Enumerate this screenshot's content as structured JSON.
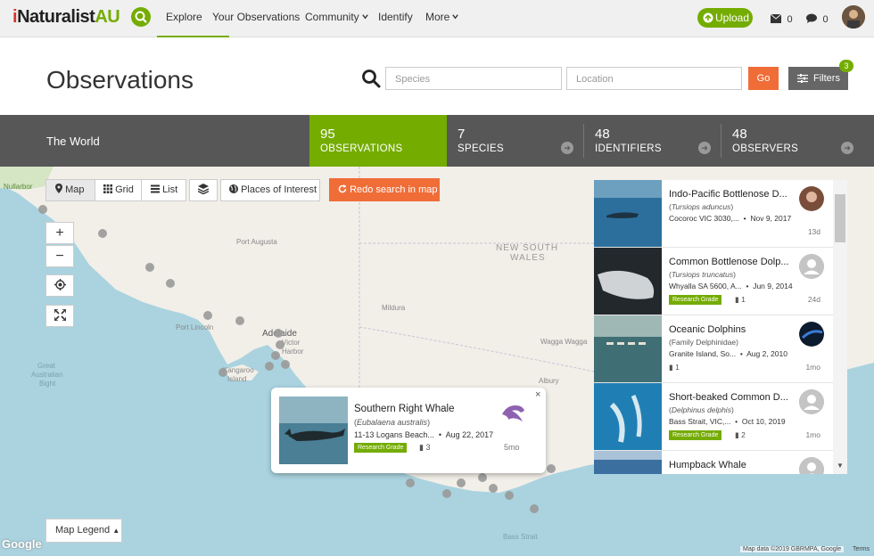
{
  "nav": {
    "logo_i": "i",
    "logo_text": "Naturalist",
    "logo_au": "AU",
    "explore": "Explore",
    "your_observations": "Your Observations",
    "community": "Community",
    "identify": "Identify",
    "more": "More",
    "upload": "Upload",
    "messages_count": "0",
    "notifications_count": "0"
  },
  "header": {
    "title": "Observations",
    "species_placeholder": "Species",
    "location_placeholder": "Location",
    "go": "Go",
    "filters": "Filters",
    "filters_badge": "3"
  },
  "stats": {
    "place": "The World",
    "items": [
      {
        "num": "95",
        "label": "OBSERVATIONS"
      },
      {
        "num": "7",
        "label": "SPECIES"
      },
      {
        "num": "48",
        "label": "IDENTIFIERS"
      },
      {
        "num": "48",
        "label": "OBSERVERS"
      }
    ]
  },
  "map": {
    "view_buttons": [
      "Map",
      "Grid",
      "List"
    ],
    "places_of_interest": "Places of Interest",
    "redo_search": "Redo search in map",
    "legend": "Map Legend",
    "attribution": "Map data ©2019 GBRMPA, Google",
    "terms": "Terms",
    "google": "Google",
    "labels": {
      "nullarbor": "Nullarbor",
      "port_augusta": "Port Augusta",
      "new_south_wales": "NEW SOUTH",
      "new_south_wales_2": "WALES",
      "mildura": "Mildura",
      "port_lincoln": "Port Lincoln",
      "adelaide": "Adelaide",
      "victor_harbor": "Victor",
      "victor_harbor_2": "Harbor",
      "wagga": "Wagga Wagga",
      "great_australian_bight": "Great",
      "great_australian_bight_2": "Australian",
      "great_australian_bight_3": "Bight",
      "kangaroo_island": "Kangaroo",
      "kangaroo_island_2": "Island",
      "albury": "Albury",
      "bass_strait": "Bass Strait"
    },
    "popup": {
      "name": "Southern Right Whale",
      "scientific": "Eubalaena australis",
      "place": "11-13 Logans Beach...",
      "date": "Aug 22, 2017",
      "grade": "Research Grade",
      "ids": "3",
      "age": "5mo"
    }
  },
  "observations": [
    {
      "name": "Indo-Pacific Bottlenose D...",
      "scientific": "Tursiops aduncus",
      "italic": true,
      "place": "Cocoroc VIC 3030,...",
      "date": "Nov 9, 2017",
      "grade": "",
      "ids": "",
      "age": "13d"
    },
    {
      "name": "Common Bottlenose Dolp...",
      "scientific": "Tursiops truncatus",
      "italic": true,
      "place": "Whyalla SA 5600, A...",
      "date": "Jun 9, 2014",
      "grade": "Research Grade",
      "ids": "1",
      "age": "24d"
    },
    {
      "name": "Oceanic Dolphins",
      "scientific": "Family Delphinidae",
      "italic": false,
      "place": "Granite Island, So...",
      "date": "Aug 2, 2010",
      "grade": "",
      "ids": "1",
      "age": "1mo"
    },
    {
      "name": "Short-beaked Common D...",
      "scientific": "Delphinus delphis",
      "italic": true,
      "place": "Bass Strait, VIC,...",
      "date": "Oct 10, 2019",
      "grade": "Research Grade",
      "ids": "2",
      "age": "1mo"
    },
    {
      "name": "Humpback Whale",
      "scientific": "",
      "italic": false,
      "place": "",
      "date": "",
      "grade": "",
      "ids": "",
      "age": ""
    }
  ]
}
